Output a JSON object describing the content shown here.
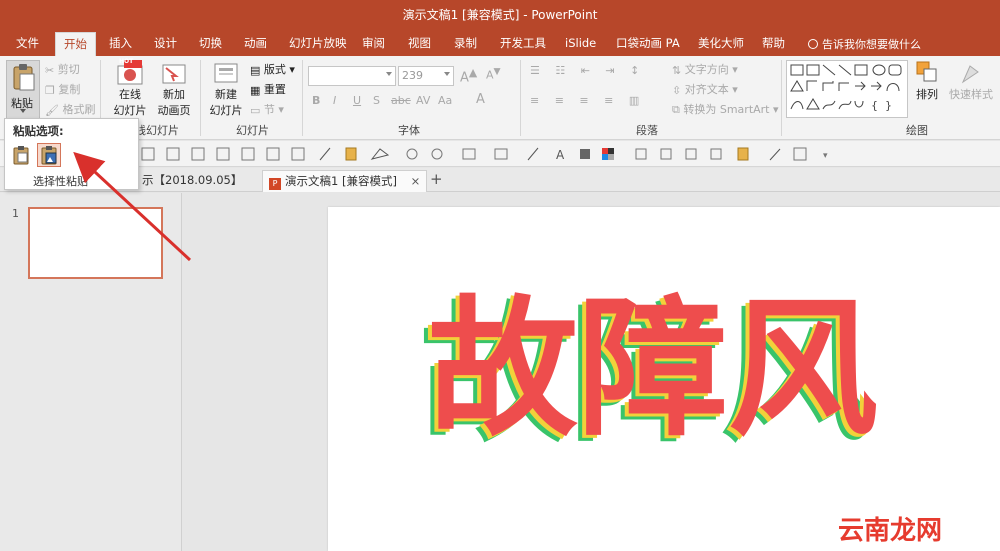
{
  "window": {
    "title": "演示文稿1 [兼容模式] - PowerPoint"
  },
  "menu_tabs": [
    "文件",
    "开始",
    "插入",
    "设计",
    "切换",
    "动画",
    "幻灯片放映",
    "审阅",
    "视图",
    "录制",
    "开发工具",
    "iSlide",
    "口袋动画 PA",
    "美化大师",
    "帮助"
  ],
  "active_tab": "开始",
  "tell_me": "告诉我你想要做什么",
  "ribbon": {
    "clipboard": {
      "paste": "粘贴",
      "cut": "剪切",
      "copy": "复制",
      "format_painter": "格式刷"
    },
    "slides": {
      "online": "在线",
      "online2": "幻灯片",
      "new_anim1": "新加",
      "new_anim2": "动画页",
      "new_slide1": "新建",
      "new_slide2": "幻灯片",
      "layout": "版式",
      "reset": "重置",
      "section": "节",
      "group_label_left": "线幻灯片",
      "group_label": "幻灯片",
      "hot_badge": "HOT"
    },
    "font": {
      "size": "239",
      "group_label": "字体",
      "bold": "B",
      "italic": "I",
      "underline": "U",
      "strike": "S",
      "shadow": "abc",
      "spacing": "AV",
      "case": "Aa",
      "color": "A"
    },
    "paragraph": {
      "text_direction": "文字方向",
      "align_text": "对齐文本",
      "smartart": "转换为 SmartArt",
      "group_label": "段落"
    },
    "drawing": {
      "arrange": "排列",
      "quick_styles": "快速样式",
      "group_label": "绘图"
    }
  },
  "paste_menu": {
    "header": "粘贴选项:",
    "special": "选择性粘贴"
  },
  "doc_tabs": [
    {
      "label": "示【2018.09.05】"
    },
    {
      "label": "演示文稿1 [兼容模式]"
    }
  ],
  "tab_close": "×",
  "tab_add": "+",
  "thumbnail": {
    "number": "1"
  },
  "slide": {
    "text": "故障风"
  },
  "watermark": "云南龙网",
  "colors": {
    "brand": "#b7472a",
    "glitch_red": "#ee4d4d",
    "glitch_green": "#39c46a",
    "glitch_yellow": "#f2d13a",
    "watermark": "#e63b2e"
  }
}
